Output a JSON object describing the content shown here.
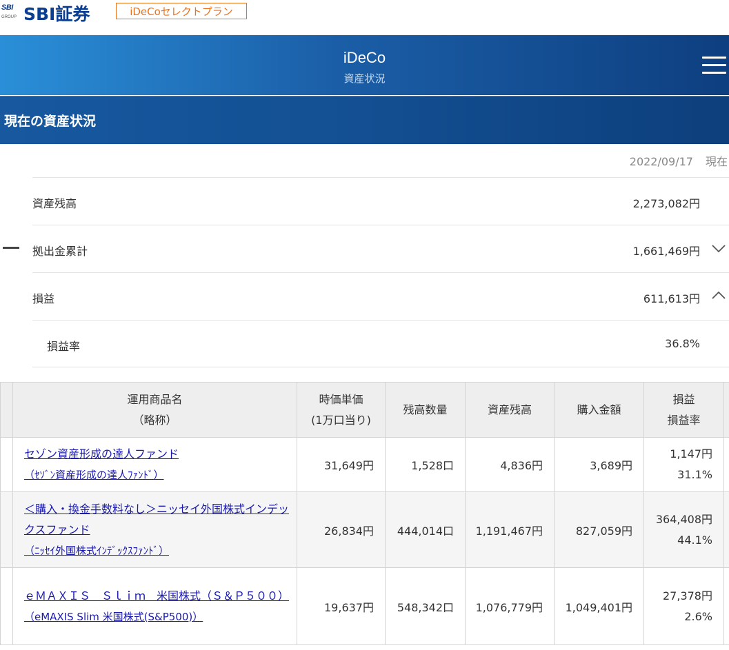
{
  "brand": {
    "logo_mark": "SBI",
    "logo_mark_sub": "GROUP",
    "logo_text": "SBI証券",
    "plan_badge": "iDeCoセレクトプラン"
  },
  "header": {
    "title": "iDeCo",
    "subtitle": "資産状況",
    "menu_icon": "hamburger-menu-icon"
  },
  "section": {
    "title": "現在の資産状況"
  },
  "summary": {
    "as_of_date": "2022/09/17",
    "as_of_suffix": "現在",
    "rows": [
      {
        "label": "資産残高",
        "value": "2,273,082円"
      },
      {
        "label": "拠出金累計",
        "value": "1,661,469円"
      },
      {
        "label": "損益",
        "value": "611,613円"
      },
      {
        "label": "損益率",
        "value": "36.8%"
      }
    ]
  },
  "table": {
    "headers": {
      "name_line1": "運用商品名",
      "name_line2": "（略称）",
      "price_line1": "時価単価",
      "price_line2": "(1万口当り)",
      "units": "残高数量",
      "balance": "資産残高",
      "purchase": "購入金額",
      "pl_line1": "損益",
      "pl_line2": "損益率"
    },
    "rows": [
      {
        "name": "セゾン資産形成の達人ファンド",
        "abbr": "（ｾｿﾞﾝ資産形成の達人ﾌｧﾝﾄﾞ）",
        "price": "31,649円",
        "units": "1,528口",
        "balance": "4,836円",
        "purchase": "3,689円",
        "pl": "1,147円",
        "pl_rate": "31.1%"
      },
      {
        "name": "＜購入・換金手数料なし＞ニッセイ外国株式インデックスファンド",
        "abbr": "（ﾆｯｾｲ外国株式ｲﾝﾃﾞｯｸｽﾌｧﾝﾄﾞ）",
        "price": "26,834円",
        "units": "444,014口",
        "balance": "1,191,467円",
        "purchase": "827,059円",
        "pl": "364,408円",
        "pl_rate": "44.1%"
      },
      {
        "name": "ｅＭＡＸＩＳ　Ｓｌｉｍ　米国株式（Ｓ＆Ｐ５００）",
        "abbr": "（eMAXIS Slim 米国株式(S&P500)）",
        "price": "19,637円",
        "units": "548,342口",
        "balance": "1,076,779円",
        "purchase": "1,049,401円",
        "pl": "27,378円",
        "pl_rate": "2.6%"
      }
    ]
  }
}
